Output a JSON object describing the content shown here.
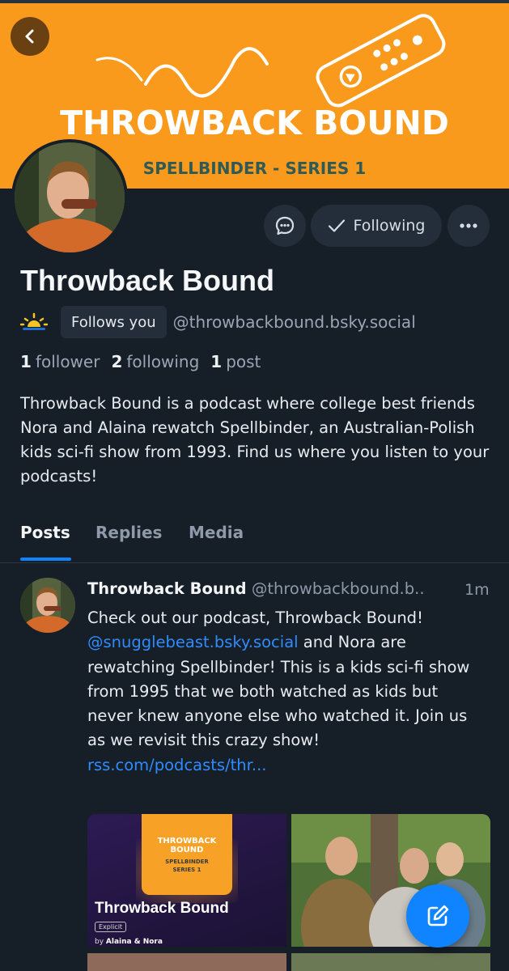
{
  "banner": {
    "title": "THROWBACK BOUND",
    "subtitle": "SPELLBINDER - SERIES 1"
  },
  "icons": {
    "back": "chevron-left-icon",
    "message": "message-icon",
    "following": "check-icon",
    "more": "ellipsis-icon",
    "status": "sunrise-emoji-icon",
    "compose": "compose-icon"
  },
  "actions": {
    "following_label": "Following"
  },
  "profile": {
    "display_name": "Throwback Bound",
    "follows_you": "Follows you",
    "handle": "@throwbackbound.bsky.social",
    "status_emoji": "🌅",
    "stats": {
      "followers_count": "1",
      "followers_label": "follower",
      "following_count": "2",
      "following_label": "following",
      "posts_count": "1",
      "posts_label": "post"
    },
    "bio": "Throwback Bound is a podcast where college best friends Nora and Alaina rewatch Spellbinder, an Australian-Polish kids sci-fi show from 1993. Find us where you listen to your podcasts!"
  },
  "tabs": [
    {
      "label": "Posts",
      "active": true
    },
    {
      "label": "Replies",
      "active": false
    },
    {
      "label": "Media",
      "active": false
    }
  ],
  "post": {
    "author_name": "Throwback Bound",
    "author_handle": "@throwbackbound.b..",
    "time": "1m",
    "text_1": "Check out our podcast, Throwback Bound!",
    "mention": "@snugglebeast.bsky.social",
    "text_2": " and Nora are rewatching Spellbinder! This is a kids sci-fi show from 1995 that we both watched as kids but never knew anyone else who watched it. Join us as we revisit this crazy show!",
    "link": "rss.com/podcasts/thr...",
    "media_card": {
      "card_title": "THROWBACK BOUND",
      "card_sub_1": "SPELLBINDER",
      "card_sub_2": "SERIES 1",
      "title": "Throwback Bound",
      "explicit": "Explicit",
      "by_prefix": "by ",
      "by_names": "Alaina & Nora"
    }
  },
  "colors": {
    "background": "#161e27",
    "banner": "#f99a1c",
    "accent": "#1083fe",
    "chip": "#242e3a"
  }
}
